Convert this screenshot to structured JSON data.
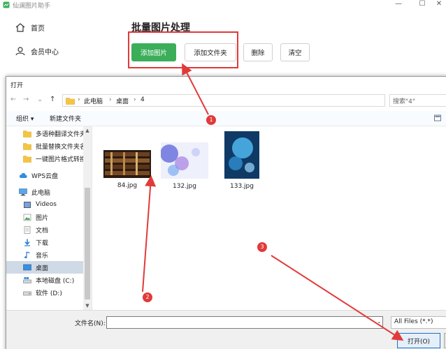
{
  "app": {
    "title": "仙澜图片助手",
    "minimize": "—",
    "maximize": "☐",
    "close": "✕"
  },
  "sidebar": {
    "items": [
      {
        "label": "首页",
        "icon": "home-icon"
      },
      {
        "label": "会员中心",
        "icon": "user-icon"
      }
    ]
  },
  "main": {
    "title": "批量图片处理",
    "buttons": {
      "add_image": "添加图片",
      "add_folder": "添加文件夹",
      "delete": "删除",
      "clear": "清空"
    }
  },
  "dialog": {
    "title": "打开",
    "nav": {
      "back": "←",
      "forward": "→",
      "recent": "⌄",
      "up": "↑"
    },
    "breadcrumb": [
      "此电脑",
      "桌面",
      "4"
    ],
    "separator": "›",
    "search_placeholder": "搜索\"4\"",
    "toolbar": {
      "organize": "组织 ▾",
      "new_folder": "新建文件夹"
    },
    "nav_pane": [
      {
        "label": "多语种翻译文件夹",
        "icon": "folder-icon"
      },
      {
        "label": "批量替换文件夹名",
        "icon": "folder-icon"
      },
      {
        "label": "一键图片格式转换",
        "icon": "folder-icon"
      },
      {
        "label": "WPS云盘",
        "icon": "cloud-icon"
      },
      {
        "label": "此电脑",
        "icon": "computer-icon"
      },
      {
        "label": "Videos",
        "icon": "video-icon"
      },
      {
        "label": "图片",
        "icon": "pictures-icon"
      },
      {
        "label": "文档",
        "icon": "documents-icon"
      },
      {
        "label": "下载",
        "icon": "download-icon"
      },
      {
        "label": "音乐",
        "icon": "music-icon"
      },
      {
        "label": "桌面",
        "icon": "desktop-icon",
        "selected": true
      },
      {
        "label": "本地磁盘 (C:)",
        "icon": "drive-icon"
      },
      {
        "label": "软件 (D:)",
        "icon": "drive-icon"
      }
    ],
    "files": [
      {
        "name": "84.jpg"
      },
      {
        "name": "132.jpg"
      },
      {
        "name": "133.jpg"
      }
    ],
    "filename_label": "文件名(N):",
    "filename_value": "",
    "file_type": "All Files (*.*)",
    "open_button": "打开(O)"
  },
  "annotations": [
    "1",
    "2",
    "3"
  ],
  "colors": {
    "accent_green": "#3cae5a",
    "annotation_red": "#e23a3a",
    "selection_blue": "#d0d9e6",
    "open_border": "#1c6fc7"
  }
}
